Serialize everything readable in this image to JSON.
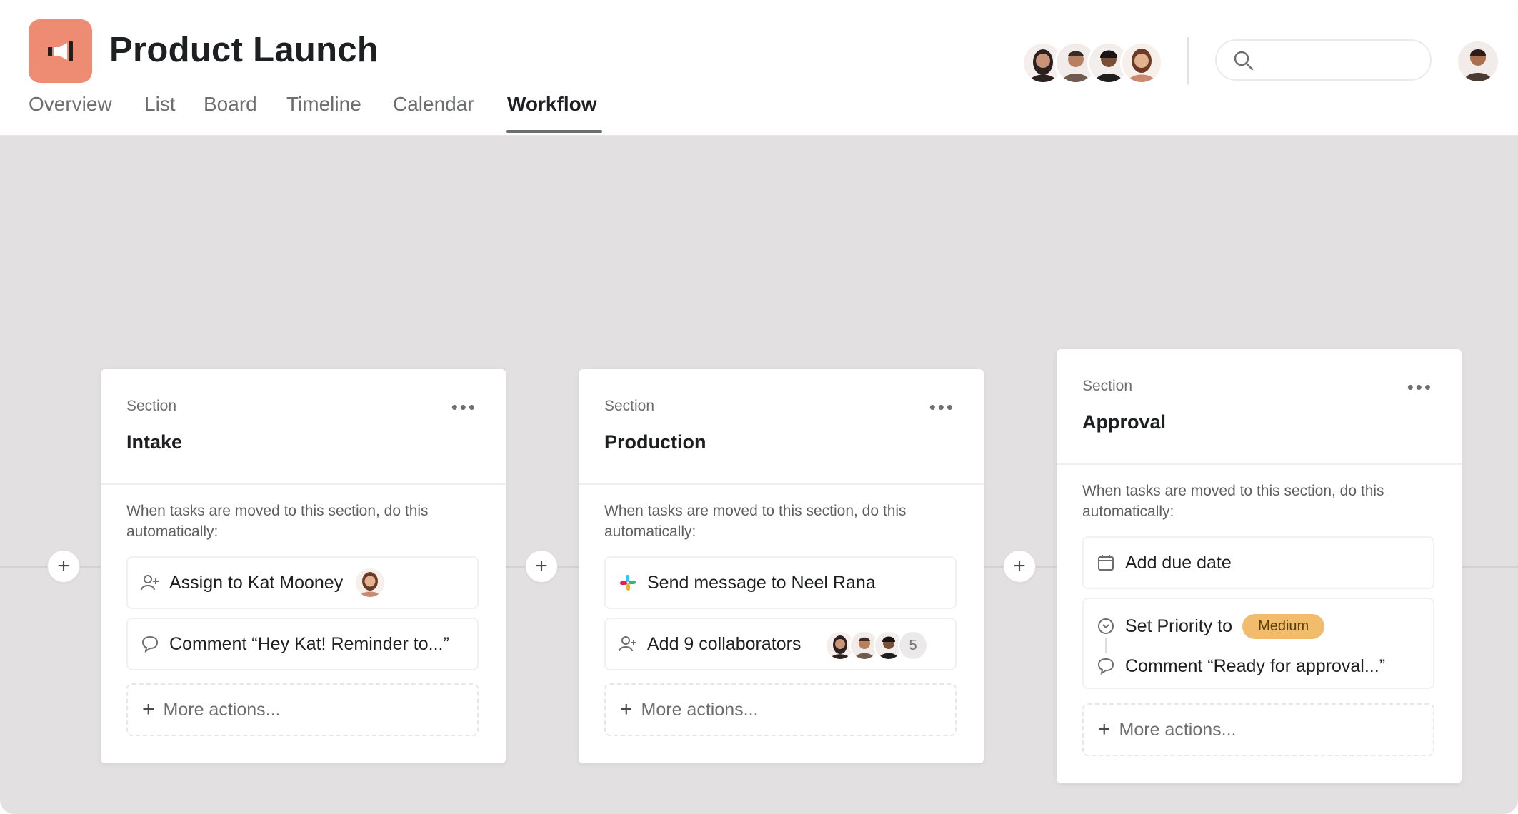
{
  "project": {
    "title": "Product Launch",
    "logo_icon": "megaphone-icon",
    "logo_color": "#ee8b73"
  },
  "tabs": [
    {
      "label": "Overview"
    },
    {
      "label": "List"
    },
    {
      "label": "Board"
    },
    {
      "label": "Timeline"
    },
    {
      "label": "Calendar"
    },
    {
      "label": "Workflow",
      "active": true
    }
  ],
  "search": {
    "placeholder": "",
    "icon": "search-icon"
  },
  "members": {
    "count_shown": 4
  },
  "sections": [
    {
      "label": "Section",
      "name": "Intake",
      "description": "When tasks are moved to this section, do this automatically:",
      "actions": [
        {
          "icon": "assign-user-icon",
          "text": "Assign to Kat Mooney",
          "has_avatar": true
        },
        {
          "icon": "comment-icon",
          "text": "Comment “Hey Kat! Reminder to...”"
        }
      ],
      "more_label": "More actions..."
    },
    {
      "label": "Section",
      "name": "Production",
      "description": "When tasks are moved to this section, do this automatically:",
      "actions": [
        {
          "icon": "slack-icon",
          "text": "Send message to Neel Rana"
        },
        {
          "icon": "collaborators-icon",
          "text": "Add 9 collaborators",
          "extra_count": "5"
        }
      ],
      "more_label": "More actions..."
    },
    {
      "label": "Section",
      "name": "Approval",
      "description": "When tasks are moved to this section, do this automatically:",
      "actions": [
        {
          "icon": "calendar-icon",
          "text": "Add due date"
        },
        {
          "icon": "priority-icon",
          "text": "Set Priority to",
          "tag": "Medium",
          "tag_color": "#f1bd6c"
        },
        {
          "icon": "comment-icon",
          "text": "Comment “Ready for approval...”"
        }
      ],
      "more_label": "More actions..."
    }
  ],
  "colors": {
    "canvas": "#e2e0e0",
    "card": "#ffffff",
    "text_primary": "#1e1f21",
    "text_secondary": "#6d6e6f"
  }
}
